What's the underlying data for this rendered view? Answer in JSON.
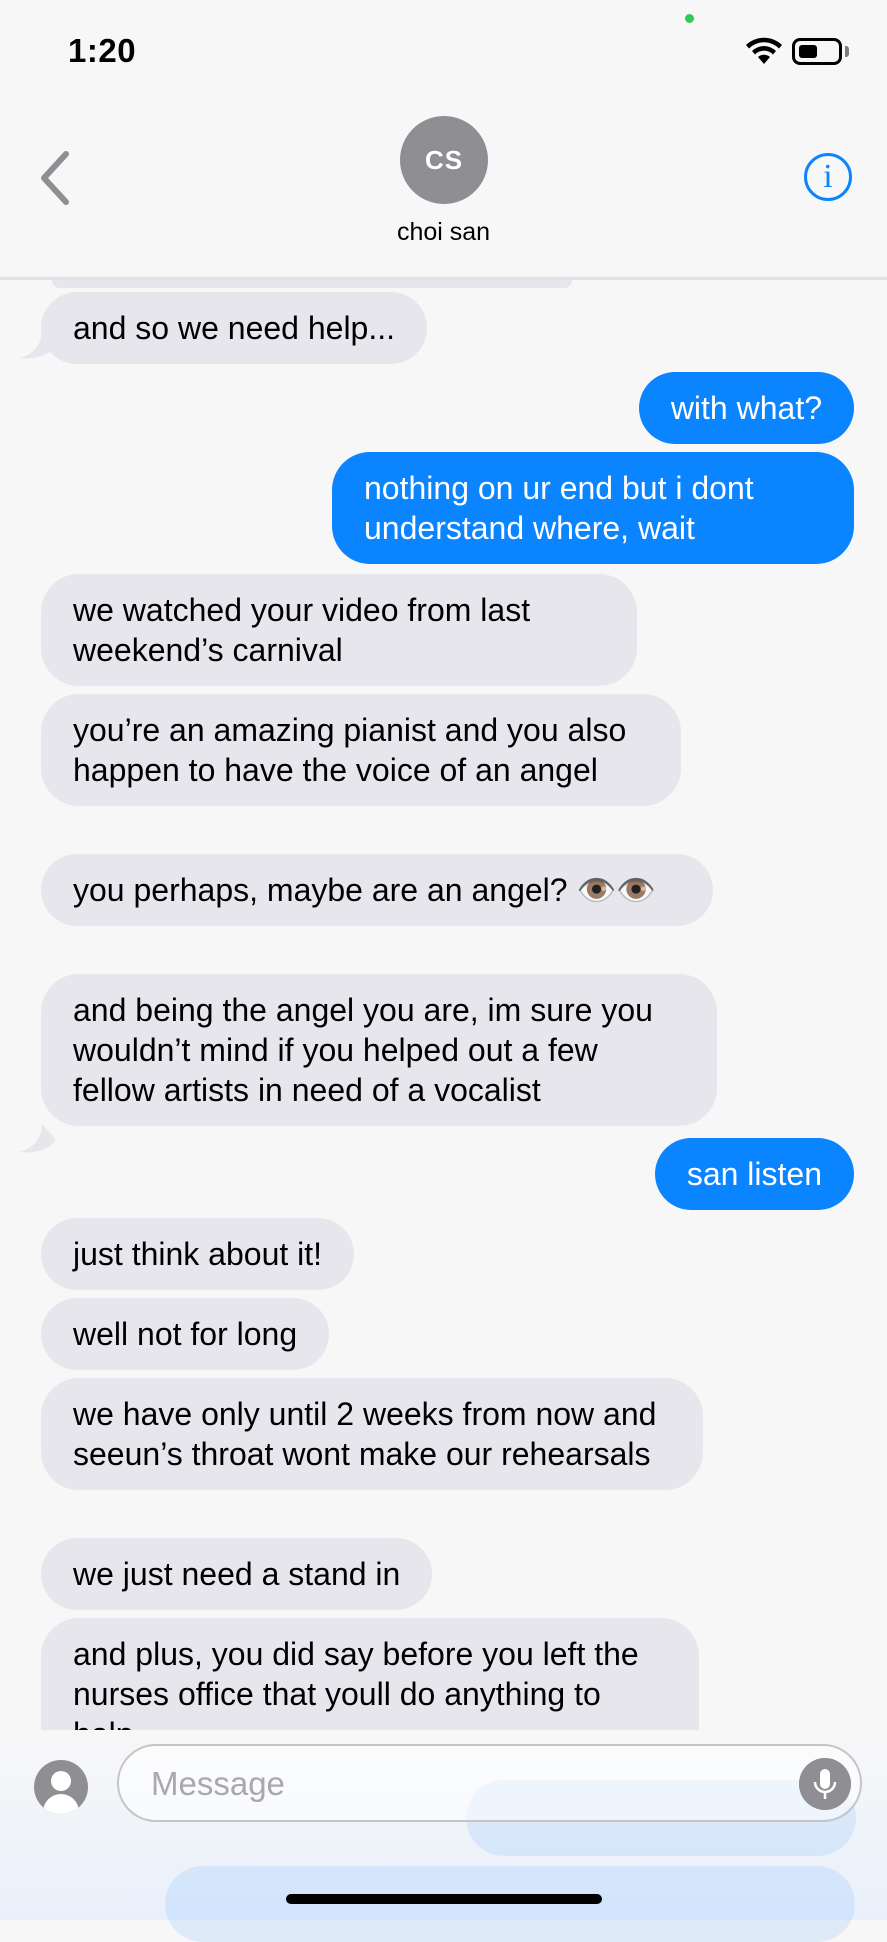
{
  "status_bar": {
    "time": "1:20"
  },
  "header": {
    "avatar_initials": "CS",
    "contact_name": "choi san",
    "info_icon": "i"
  },
  "messages": [
    {
      "from": "them",
      "text": "and so we need help..."
    },
    {
      "from": "me",
      "text": "with what?"
    },
    {
      "from": "me",
      "text": "nothing on ur end but i dont understand where, wait"
    },
    {
      "from": "them",
      "text": "we watched your video from last weekend’s carnival"
    },
    {
      "from": "them",
      "text": "you’re an amazing pianist and you also happen to have the voice of an angel"
    },
    {
      "from": "them",
      "text": "you perhaps, maybe are an angel? 👁️👁️"
    },
    {
      "from": "them",
      "text": "and being the angel you are, im sure you wouldn’t mind if you helped out a few fellow artists in need of a vocalist"
    },
    {
      "from": "me",
      "text": "san listen"
    },
    {
      "from": "them",
      "text": "just think about it!"
    },
    {
      "from": "them",
      "text": "well not for long"
    },
    {
      "from": "them",
      "text": "we have only until 2 weeks from now and seeun’s throat wont make our rehearsals"
    },
    {
      "from": "them",
      "text": "we just need a stand in"
    },
    {
      "from": "them",
      "text": "and plus, you did say before you left the nurses office that youll do anything to help"
    }
  ],
  "composer": {
    "placeholder": "Message"
  },
  "colors": {
    "outgoing": "#0a84ff",
    "incoming": "#e7e6ec",
    "accent": "#0a84ff"
  }
}
